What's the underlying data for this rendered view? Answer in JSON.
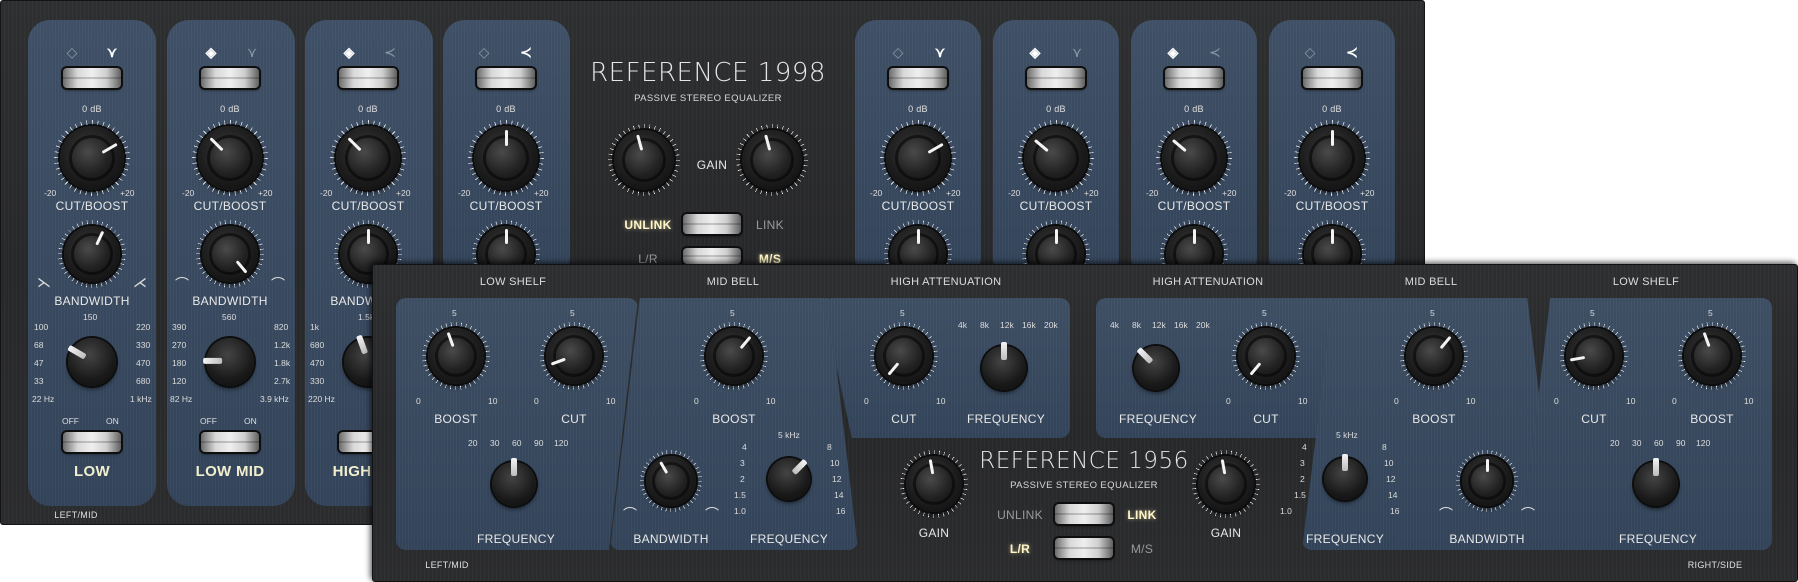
{
  "p1998": {
    "title": "REFERENCE 1998",
    "subtitle": "PASSIVE STEREO EQUALIZER",
    "gain_label": "GAIN",
    "unlink_label": "UNLINK",
    "link_label": "LINK",
    "lr_label": "L/R",
    "ms_label": "M/S",
    "footer_left": "LEFT/MID",
    "cut_boost_top": "0 dB",
    "cut_boost_min": "-20",
    "cut_boost_max": "+20",
    "cut_boost_label": "CUT/BOOST",
    "bandwidth_label": "BANDWIDTH",
    "off_label": "OFF",
    "on_label": "ON",
    "bands": [
      {
        "name": "LOW",
        "freqs": [
          "100",
          "150",
          "220",
          "68",
          "330",
          "47",
          "470",
          "33",
          "680",
          "22 Hz",
          "1 kHz"
        ]
      },
      {
        "name": "LOW MID",
        "freqs": [
          "390",
          "560",
          "820",
          "270",
          "1.2k",
          "180",
          "1.8k",
          "120",
          "2.7k",
          "82 Hz",
          "3.9 kHz"
        ]
      },
      {
        "name": "HIGH",
        "freqs": [
          "1k",
          "1.5k",
          "680",
          "470",
          "330",
          "220 Hz"
        ]
      }
    ]
  },
  "p1956": {
    "title": "REFERENCE 1956",
    "subtitle": "PASSIVE STEREO EQUALIZER",
    "unlink_label": "UNLINK",
    "link_label": "LINK",
    "lr_label": "L/R",
    "ms_label": "M/S",
    "gain_label": "GAIN",
    "footer_left": "LEFT/MID",
    "footer_right": "RIGHT/SIDE",
    "headers": [
      "LOW SHELF",
      "MID BELL",
      "HIGH ATTENUATION",
      "HIGH ATTENUATION",
      "MID BELL",
      "LOW SHELF"
    ],
    "boost_label": "BOOST",
    "cut_label": "CUT",
    "frequency_label": "FREQUENCY",
    "bandwidth_label": "BANDWIDTH",
    "knob_top": "5",
    "knob_min": "0",
    "knob_max": "10",
    "low_freqs": [
      "20",
      "30",
      "60",
      "90",
      "120"
    ],
    "mid_freqs": [
      "5 kHz",
      "4",
      "8",
      "3",
      "10",
      "2",
      "12",
      "1.5",
      "14",
      "1.0",
      "16"
    ],
    "high_freqs": [
      "4k",
      "8k",
      "12k",
      "16k",
      "20k"
    ]
  }
}
